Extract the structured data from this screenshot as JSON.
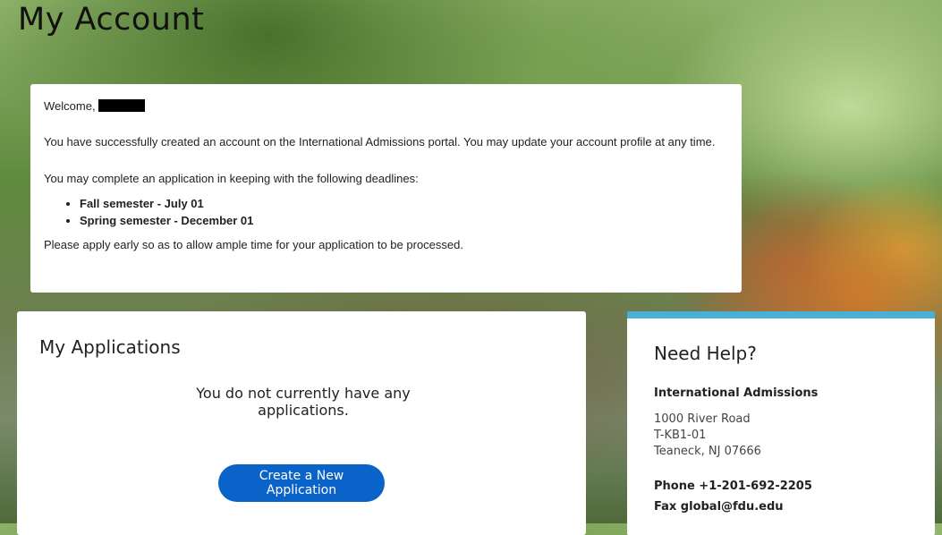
{
  "page": {
    "title": "My Account"
  },
  "welcome_card": {
    "greeting": "Welcome,",
    "intro": "You have successfully created an account on the International Admissions portal. You may update your account profile at any time.",
    "deadlines_intro": "You may complete an application in keeping with the following deadlines:",
    "deadlines": [
      "Fall semester - July 01",
      "Spring semester - December 01"
    ],
    "note": "Please apply early so as to allow ample time for your application to be processed."
  },
  "applications": {
    "title": "My Applications",
    "empty_message": "You do not currently have any applications.",
    "create_button": "Create a New Application"
  },
  "help": {
    "title": "Need Help?",
    "org": "International Admissions",
    "address": [
      "1000 River Road",
      "T-KB1-01",
      "Teaneck, NJ 07666"
    ],
    "phone": "Phone +1-201-692-2205",
    "fax": "Fax global@fdu.edu"
  },
  "colors": {
    "button": "#0a63c9",
    "help_accent": "#4aafd5"
  }
}
